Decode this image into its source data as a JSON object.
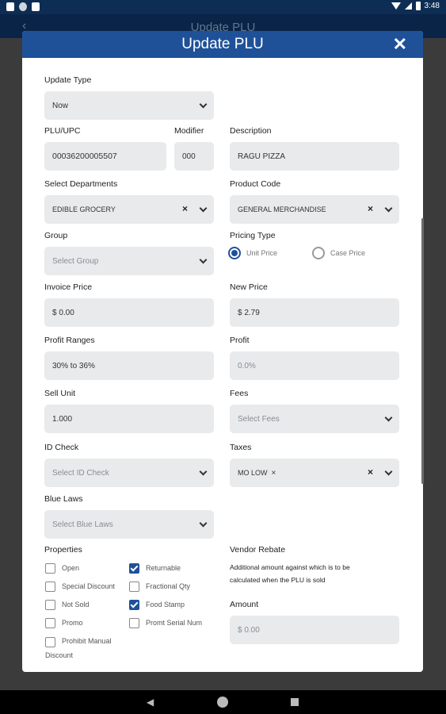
{
  "status": {
    "time": "3:48"
  },
  "appbar": {
    "title": "Update PLU",
    "back": "‹"
  },
  "modal": {
    "title": "Update PLU",
    "close": "✕",
    "update_type": {
      "label": "Update Type",
      "value": "Now"
    },
    "plu": {
      "label": "PLU/UPC",
      "value": "00036200005507"
    },
    "modifier": {
      "label": "Modifier",
      "value": "000"
    },
    "description": {
      "label": "Description",
      "value": "RAGU PIZZA"
    },
    "departments": {
      "label": "Select Departments",
      "value": "EDIBLE GROCERY",
      "clear": "×"
    },
    "product_code": {
      "label": "Product Code",
      "value": "GENERAL MERCHANDISE",
      "clear": "×"
    },
    "group": {
      "label": "Group",
      "placeholder": "Select Group"
    },
    "pricing_type": {
      "label": "Pricing Type",
      "options": [
        "Unit Price",
        "Case Price"
      ],
      "selected": "Unit Price"
    },
    "invoice_price": {
      "label": "Invoice Price",
      "value": "$ 0.00"
    },
    "new_price": {
      "label": "New Price",
      "value": "$ 2.79"
    },
    "profit_ranges": {
      "label": "Profit Ranges",
      "value": "30% to 36%"
    },
    "profit": {
      "label": "Profit",
      "value": "0.0%"
    },
    "sell_unit": {
      "label": "Sell Unit",
      "value": "1.000"
    },
    "fees": {
      "label": "Fees",
      "placeholder": "Select Fees"
    },
    "id_check": {
      "label": "ID Check",
      "placeholder": "Select ID Check"
    },
    "taxes": {
      "label": "Taxes",
      "value": "MO LOW",
      "tag_remove": "×",
      "clear": "×"
    },
    "blue_laws": {
      "label": "Blue Laws",
      "placeholder": "Select Blue Laws"
    },
    "properties": {
      "label": "Properties",
      "items": [
        {
          "label": "Open",
          "checked": false
        },
        {
          "label": "Returnable",
          "checked": true
        },
        {
          "label": "Special Discount",
          "checked": false
        },
        {
          "label": "Fractional Qty",
          "checked": false
        },
        {
          "label": "Not Sold",
          "checked": false
        },
        {
          "label": "Food Stamp",
          "checked": true
        },
        {
          "label": "Promo",
          "checked": false
        },
        {
          "label": "Promt Serial Num",
          "checked": false
        },
        {
          "label_line1": "Prohibit Manual",
          "label_line2": "Discount",
          "checked": false
        }
      ]
    },
    "vendor_rebate": {
      "label": "Vendor Rebate",
      "note_line1": "Additional amount against which is to be",
      "note_line2": "calculated when the PLU is sold",
      "amount_label": "Amount",
      "amount_value": "$ 0.00"
    }
  }
}
